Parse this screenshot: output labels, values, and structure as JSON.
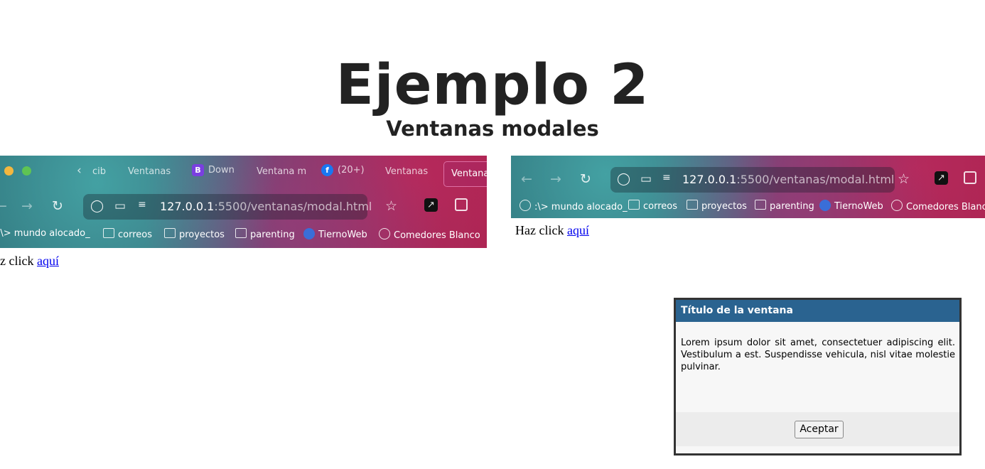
{
  "page": {
    "title": "Ejemplo 2",
    "subtitle": "Ventanas modales"
  },
  "screenshot1": {
    "tabs": [
      "cib",
      "Ventanas",
      "Down",
      "Ventana m",
      "(20+)",
      "Ventanas",
      "Ventana"
    ],
    "tab_icons": {
      "bootstrap": "B",
      "facebook": "f"
    },
    "url_host": "127.0.0.1",
    "url_rest": ":5500/ventanas/modal.html",
    "bookmarks": [
      ":\\> mundo alocado_",
      "correos",
      "proyectos",
      "parenting",
      "TiernoWeb",
      "Comedores Blanco"
    ],
    "click_prefix": "z click",
    "click_link": "aquí"
  },
  "screenshot2": {
    "url_host": "127.0.0.1",
    "url_rest": ":5500/ventanas/modal.html",
    "bookmarks": [
      ":\\> mundo alocado_",
      "correos",
      "proyectos",
      "parenting",
      "TiernoWeb",
      "Comedores Blanco"
    ],
    "click_prefix": "Haz click",
    "click_link": "aquí"
  },
  "modal": {
    "title": "Título de la ventana",
    "body": "Lorem ipsum dolor sit amet, consectetuer adipiscing elit. Vestibulum a est. Suspendisse vehicula, nisl vitae molestie pulvinar.",
    "button": "Aceptar"
  },
  "colors": {
    "modal_header": "#2a6390",
    "link": "#0000ee",
    "heading": "#222222"
  },
  "icons": [
    "back-arrow-icon",
    "forward-arrow-icon",
    "reload-icon",
    "shield-icon",
    "page-icon",
    "site-settings-icon",
    "star-icon",
    "extension-icon",
    "sidebar-icon",
    "folder-icon",
    "globe-icon"
  ]
}
